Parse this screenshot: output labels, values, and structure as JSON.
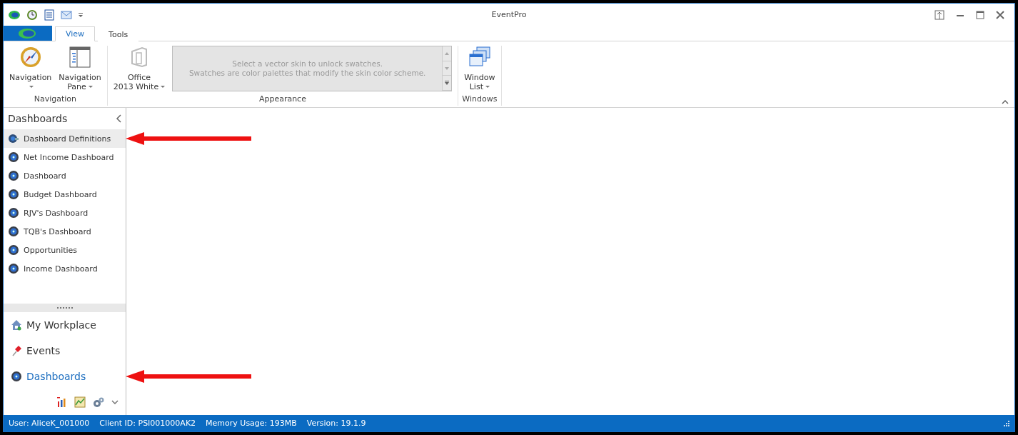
{
  "window": {
    "title": "EventPro"
  },
  "ribbon": {
    "tabs": [
      {
        "label": "View",
        "selected": true
      },
      {
        "label": "Tools",
        "selected": false
      }
    ],
    "groups": [
      {
        "label": "Navigation",
        "buttons": [
          {
            "kind": "compass",
            "lines": [
              "Navigation"
            ]
          },
          {
            "kind": "pane",
            "lines": [
              "Navigation",
              "Pane"
            ]
          }
        ]
      },
      {
        "label": "Appearance",
        "buttons": [
          {
            "kind": "office",
            "lines": [
              "Office",
              "2013 White"
            ]
          }
        ],
        "gallery": {
          "lines": [
            "Select a vector skin to unlock swatches.",
            "Swatches are color palettes that modify the skin color scheme."
          ],
          "disabled": true
        }
      },
      {
        "label": "Windows",
        "buttons": [
          {
            "kind": "windows",
            "lines": [
              "Window",
              "List"
            ]
          }
        ]
      }
    ]
  },
  "sidebar": {
    "title": "Dashboards",
    "items": [
      {
        "label": "Dashboard Definitions",
        "kind": "definitions",
        "selected": true,
        "pointed": true
      },
      {
        "label": "Net Income Dashboard",
        "kind": "dashboard",
        "selected": false,
        "pointed": false
      },
      {
        "label": "Dashboard",
        "kind": "dashboard",
        "selected": false,
        "pointed": false
      },
      {
        "label": "Budget Dashboard",
        "kind": "dashboard",
        "selected": false,
        "pointed": false
      },
      {
        "label": "RJV's Dashboard",
        "kind": "dashboard",
        "selected": false,
        "pointed": false
      },
      {
        "label": "TQB's Dashboard",
        "kind": "dashboard",
        "selected": false,
        "pointed": false
      },
      {
        "label": "Opportunities",
        "kind": "dashboard",
        "selected": false,
        "pointed": false
      },
      {
        "label": "Income Dashboard",
        "kind": "dashboard",
        "selected": false,
        "pointed": false
      }
    ],
    "modules": [
      {
        "label": "My Workplace",
        "kind": "house",
        "selected": false,
        "pointed": false
      },
      {
        "label": "Events",
        "kind": "pin",
        "selected": false,
        "pointed": false
      },
      {
        "label": "Dashboards",
        "kind": "dashboard",
        "selected": true,
        "pointed": true
      }
    ]
  },
  "status_bar": [
    "User: AliceK_001000",
    "Client ID: PSI001000AK2",
    "Memory Usage: 193MB",
    "Version: 19.1.9"
  ]
}
